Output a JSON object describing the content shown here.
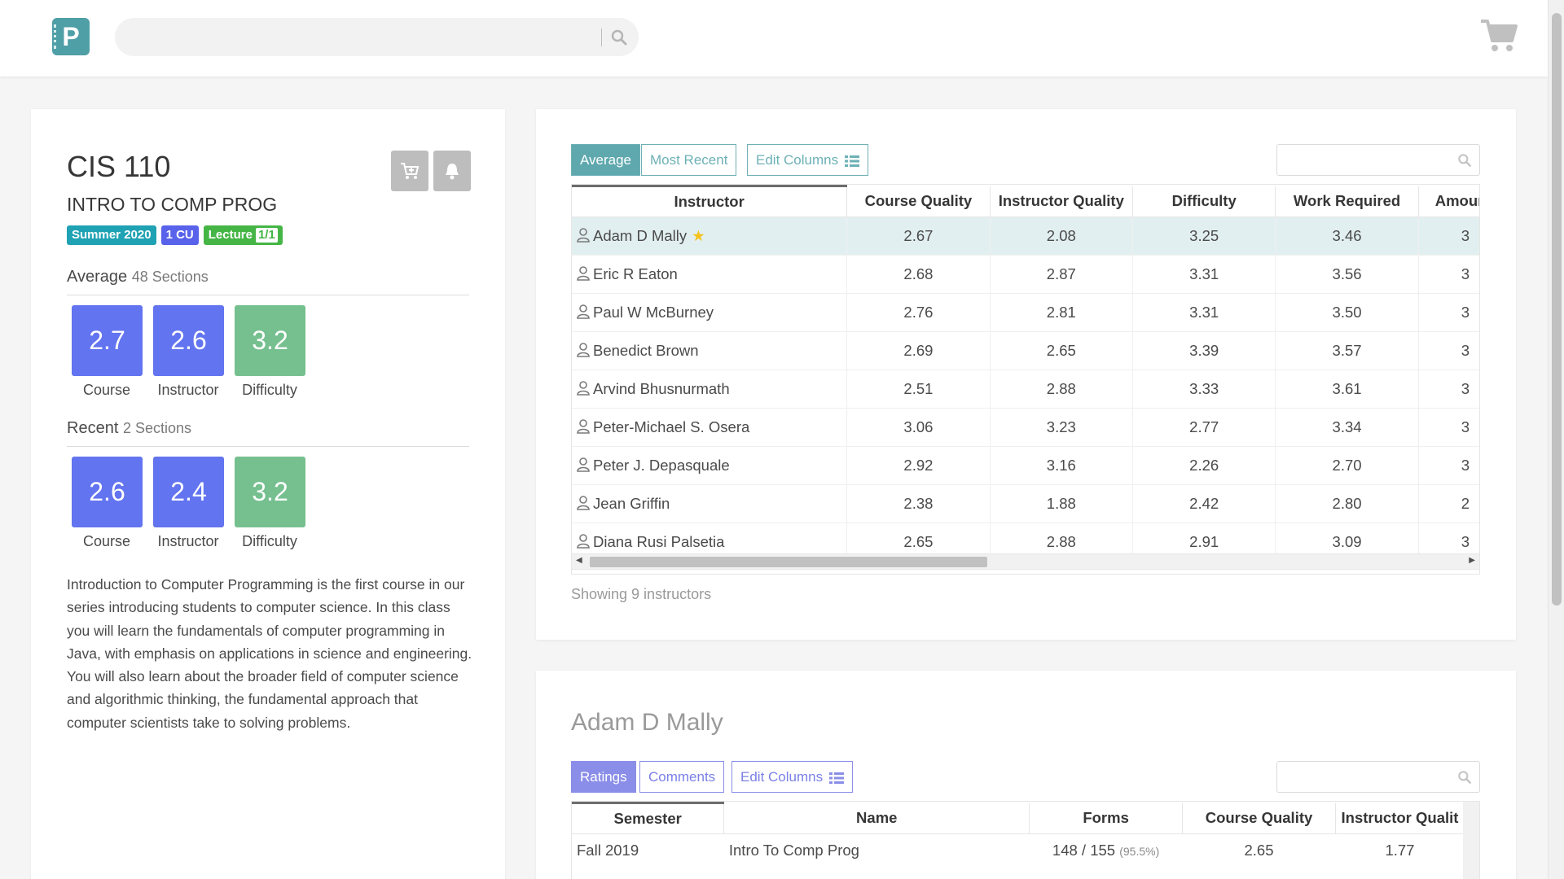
{
  "nav": {
    "logo_letter": "P",
    "search_placeholder": ""
  },
  "course": {
    "code": "CIS 110",
    "title": "INTRO TO COMP PROG",
    "tags": {
      "semester": "Summer 2020",
      "cu": "1 CU",
      "type": "Lecture",
      "type_count": "1/1"
    },
    "description": "Introduction to Computer Programming is the first course in our series introducing students to computer science. In this class you will learn the fundamentals of computer programming in Java, with emphasis on applications in science and engineering. You will also learn about the broader field of computer science and algorithmic thinking, the fundamental approach that computer scientists take to solving problems."
  },
  "average": {
    "label": "Average",
    "sections": "48 Sections",
    "scores": [
      {
        "value": "2.7",
        "label": "Course"
      },
      {
        "value": "2.6",
        "label": "Instructor"
      },
      {
        "value": "3.2",
        "label": "Difficulty"
      }
    ]
  },
  "recent": {
    "label": "Recent",
    "sections": "2 Sections",
    "scores": [
      {
        "value": "2.6",
        "label": "Course"
      },
      {
        "value": "2.4",
        "label": "Instructor"
      },
      {
        "value": "3.2",
        "label": "Difficulty"
      }
    ]
  },
  "instructors_panel": {
    "tab_average": "Average",
    "tab_recent": "Most Recent",
    "edit_columns": "Edit Columns",
    "columns": [
      "Instructor",
      "Course Quality",
      "Instructor Quality",
      "Difficulty",
      "Work Required",
      "Amoun"
    ],
    "rows": [
      {
        "name": "Adam D Mally",
        "starred": true,
        "cq": "2.67",
        "iq": "2.08",
        "diff": "3.25",
        "work": "3.46",
        "amount": "3"
      },
      {
        "name": "Eric R Eaton",
        "cq": "2.68",
        "iq": "2.87",
        "diff": "3.31",
        "work": "3.56",
        "amount": "3"
      },
      {
        "name": "Paul W McBurney",
        "cq": "2.76",
        "iq": "2.81",
        "diff": "3.31",
        "work": "3.50",
        "amount": "3"
      },
      {
        "name": "Benedict Brown",
        "cq": "2.69",
        "iq": "2.65",
        "diff": "3.39",
        "work": "3.57",
        "amount": "3"
      },
      {
        "name": "Arvind Bhusnurmath",
        "cq": "2.51",
        "iq": "2.88",
        "diff": "3.33",
        "work": "3.61",
        "amount": "3"
      },
      {
        "name": "Peter-Michael S. Osera",
        "cq": "3.06",
        "iq": "3.23",
        "diff": "2.77",
        "work": "3.34",
        "amount": "3"
      },
      {
        "name": "Peter J. Depasquale",
        "cq": "2.92",
        "iq": "3.16",
        "diff": "2.26",
        "work": "2.70",
        "amount": "3"
      },
      {
        "name": "Jean Griffin",
        "cq": "2.38",
        "iq": "1.88",
        "diff": "2.42",
        "work": "2.80",
        "amount": "2"
      },
      {
        "name": "Diana Rusi Palsetia",
        "cq": "2.65",
        "iq": "2.88",
        "diff": "2.91",
        "work": "3.09",
        "amount": "3"
      }
    ],
    "showing": "Showing 9 instructors"
  },
  "detail_panel": {
    "instructor_name": "Adam D Mally",
    "tab_ratings": "Ratings",
    "tab_comments": "Comments",
    "edit_columns": "Edit Columns",
    "columns": [
      "Semester",
      "Name",
      "Forms",
      "Course Quality",
      "Instructor Qualit"
    ],
    "rows": [
      {
        "semester": "Fall 2019",
        "name": "Intro To Comp Prog",
        "forms": "148 / 155",
        "pct": "(95.5%)",
        "cq": "2.65",
        "iq": "1.77"
      }
    ]
  },
  "colors": {
    "accent_teal": "#5ea8ae",
    "score_purple": "#6274ef",
    "score_green": "#76c08f",
    "tag_teal": "#1fa2b4",
    "tag_blue": "#5862ea",
    "tag_green": "#45b546"
  }
}
